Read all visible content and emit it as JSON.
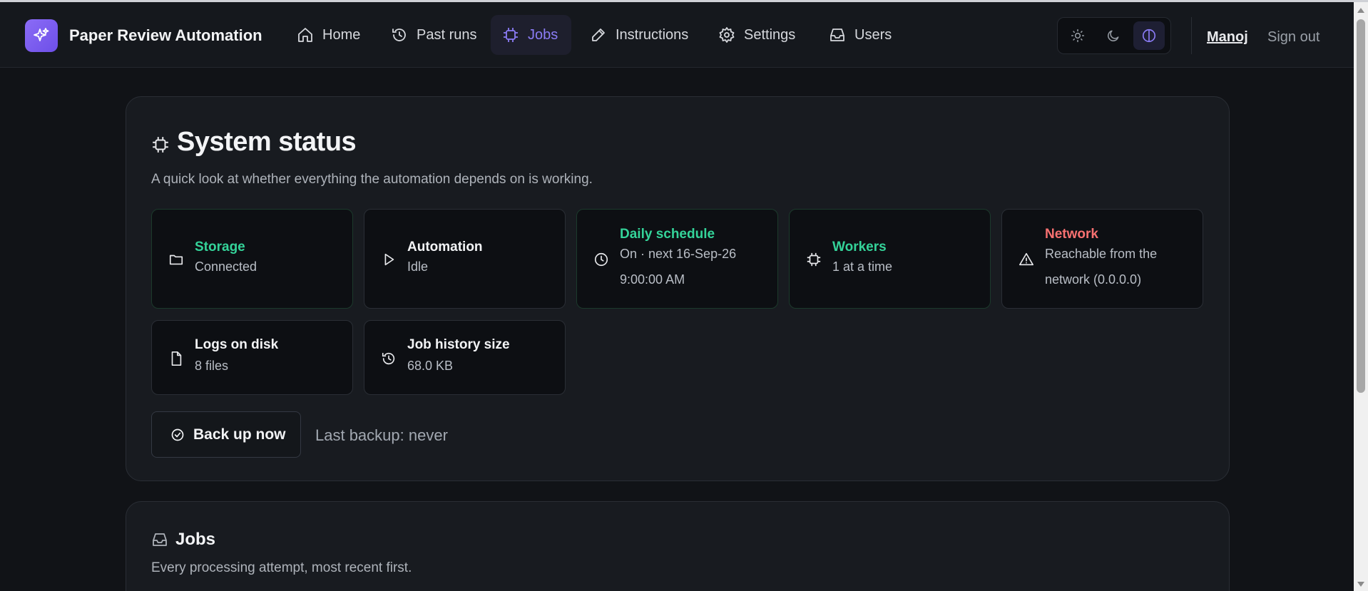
{
  "app": {
    "title": "Paper Review Automation"
  },
  "nav": {
    "items": [
      {
        "label": "Home",
        "icon": "home-icon"
      },
      {
        "label": "Past runs",
        "icon": "history-icon"
      },
      {
        "label": "Jobs",
        "icon": "cpu-icon",
        "active": true
      },
      {
        "label": "Instructions",
        "icon": "pencil-icon"
      },
      {
        "label": "Settings",
        "icon": "gear-icon"
      },
      {
        "label": "Users",
        "icon": "inbox-icon"
      }
    ],
    "theme": {
      "options": [
        "light",
        "dark",
        "system"
      ],
      "selected": "system"
    },
    "user": "Manoj",
    "signout": "Sign out"
  },
  "status": {
    "title": "System status",
    "subtitle": "A quick look at whether everything the automation depends on is working.",
    "cards": {
      "storage": {
        "title": "Storage",
        "value": "Connected",
        "icon": "folder-icon",
        "state": "ok"
      },
      "automation": {
        "title": "Automation",
        "value": "Idle",
        "icon": "play-icon",
        "state": "neutral"
      },
      "schedule": {
        "title": "Daily schedule",
        "value": "On · next 16-Sep-26 9:00:00 AM",
        "icon": "clock-icon",
        "state": "ok"
      },
      "workers": {
        "title": "Workers",
        "value": "1 at a time",
        "icon": "cpu-icon",
        "state": "ok"
      },
      "network": {
        "title": "Network",
        "value": "Reachable from the network (0.0.0.0)",
        "icon": "warning-icon",
        "state": "warning"
      },
      "logs": {
        "title": "Logs on disk",
        "value": "8 files",
        "icon": "file-icon",
        "state": "neutral"
      },
      "history": {
        "title": "Job history size",
        "value": "68.0 KB",
        "icon": "history-icon",
        "state": "neutral"
      }
    },
    "backup_button": "Back up now",
    "last_backup": "Last backup: never"
  },
  "jobs": {
    "title": "Jobs",
    "subtitle": "Every processing attempt, most recent first."
  },
  "colors": {
    "accent": "#8b7cf6",
    "ok": "#34d399",
    "warning": "#f87171",
    "background": "#111317",
    "panel": "#181b20"
  }
}
